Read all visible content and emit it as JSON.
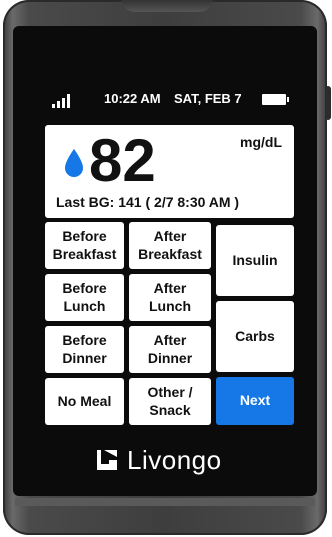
{
  "status_bar": {
    "signal_icon": "signal-strength-icon",
    "time": "10:22 AM",
    "date": "SAT, FEB 7",
    "battery_icon": "battery-icon"
  },
  "reading": {
    "drop_icon": "blood-drop-icon",
    "drop_color": "#1677e6",
    "value": "82",
    "unit": "mg/dL",
    "last_bg": "Last BG: 141 ( 2/7 8:30 AM )"
  },
  "meal_buttons": {
    "before_breakfast": "Before\nBreakfast",
    "after_breakfast": "After\nBreakfast",
    "before_lunch": "Before\nLunch",
    "after_lunch": "After\nLunch",
    "before_dinner": "Before\nDinner",
    "after_dinner": "After\nDinner",
    "no_meal": "No Meal",
    "other_snack": "Other /\nSnack"
  },
  "side_buttons": {
    "insulin": "Insulin",
    "carbs": "Carbs",
    "next": "Next"
  },
  "colors": {
    "accent": "#1677e6",
    "screen_bg": "#0b0b0b",
    "button_bg": "#ffffff"
  },
  "brand": {
    "logo_icon": "livongo-logo-icon",
    "name": "Livongo"
  }
}
